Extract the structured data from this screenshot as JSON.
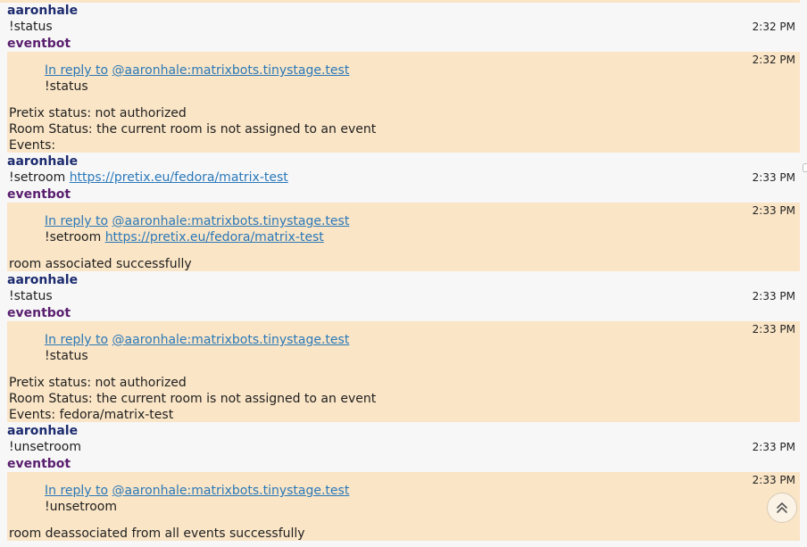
{
  "conversation": [
    {
      "sender": "aaronhale",
      "type": "user",
      "text": "!status",
      "time": "2:32 PM"
    },
    {
      "sender": "eventbot",
      "type": "bot",
      "time": "2:32 PM",
      "reply_prefix": "In reply to",
      "reply_user": "@aaronhale:matrixbots.tinystage.test",
      "quoted": "!status",
      "lines": [
        "Pretix status: not authorized",
        "Room Status: the current room is not assigned to an event",
        "Events:"
      ]
    },
    {
      "sender": "aaronhale",
      "type": "user",
      "text": "!setroom",
      "link": "https://pretix.eu/fedora/matrix-test",
      "time": "2:33 PM"
    },
    {
      "sender": "eventbot",
      "type": "bot",
      "time": "2:33 PM",
      "reply_prefix": "In reply to",
      "reply_user": "@aaronhale:matrixbots.tinystage.test",
      "quoted": "!setroom",
      "quoted_link": "https://pretix.eu/fedora/matrix-test",
      "lines": [
        "room associated successfully"
      ]
    },
    {
      "sender": "aaronhale",
      "type": "user",
      "text": "!status",
      "time": "2:33 PM"
    },
    {
      "sender": "eventbot",
      "type": "bot",
      "time": "2:33 PM",
      "reply_prefix": "In reply to",
      "reply_user": "@aaronhale:matrixbots.tinystage.test",
      "quoted": "!status",
      "lines": [
        "Pretix status: not authorized",
        "Room Status: the current room is not assigned to an event",
        "Events: fedora/matrix-test"
      ]
    },
    {
      "sender": "aaronhale",
      "type": "user",
      "text": "!unsetroom",
      "time": "2:33 PM"
    },
    {
      "sender": "eventbot",
      "type": "bot",
      "time": "2:33 PM",
      "reply_prefix": "In reply to",
      "reply_user": "@aaronhale:matrixbots.tinystage.test",
      "quoted": "!unsetroom",
      "lines": [
        "room deassociated from all events successfully"
      ]
    }
  ],
  "scroll_button_icon": "double-chevron-up-icon",
  "colors": {
    "bot_bg": "#fae5c6",
    "user_sender": "#1c2b6e",
    "bot_sender": "#5a1e6e",
    "link": "#2a78b8"
  }
}
